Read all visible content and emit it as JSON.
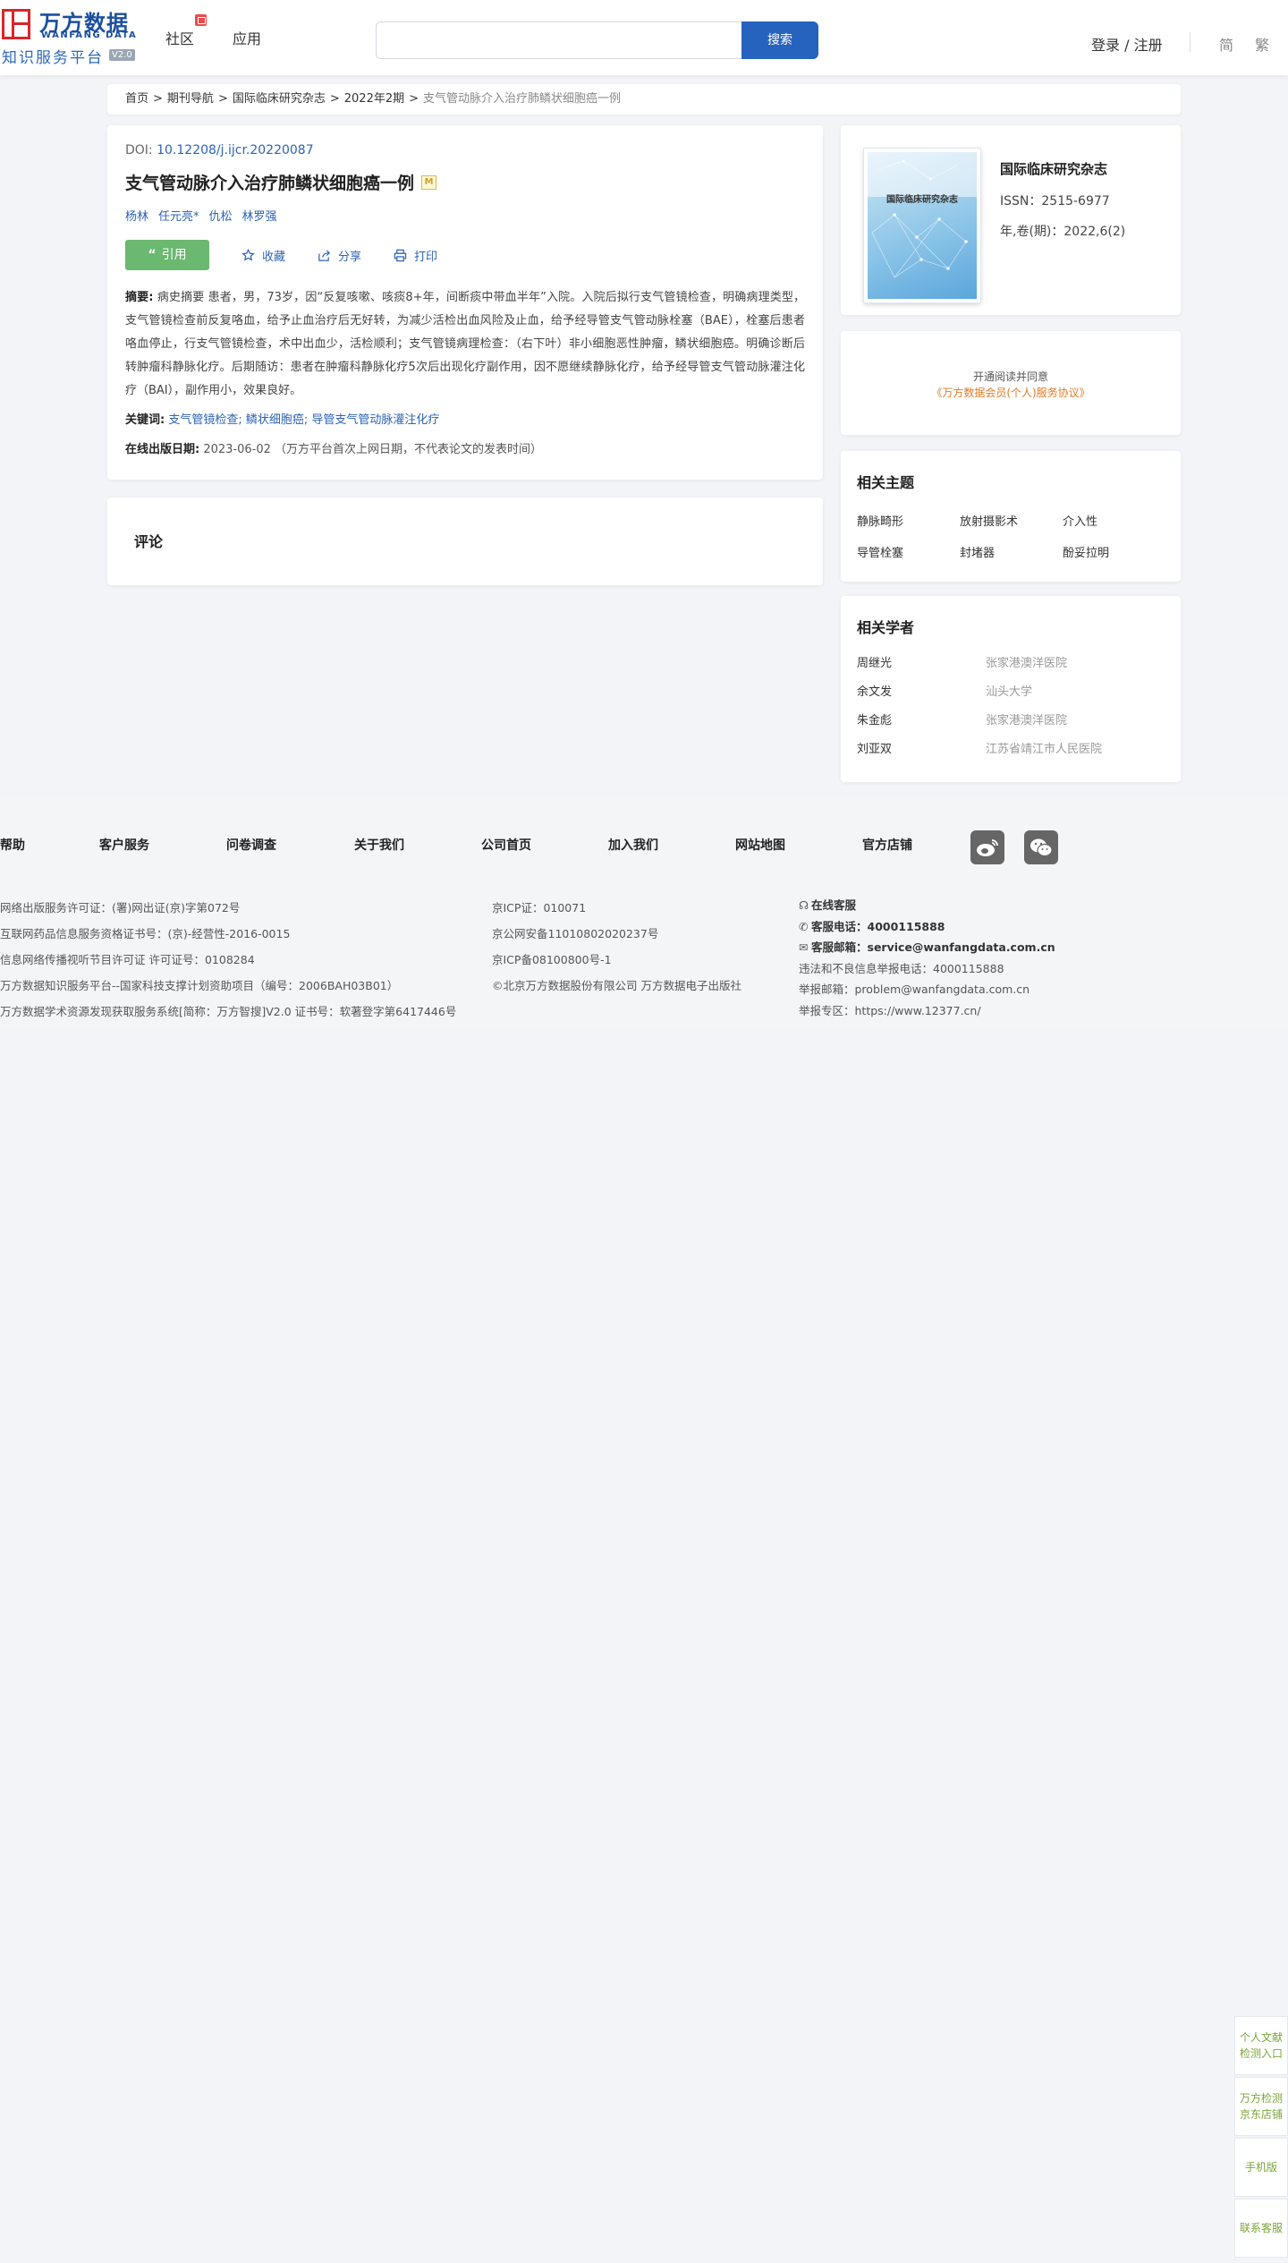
{
  "header": {
    "logo_cn": "万方数据",
    "logo_en": "WANFANG DATA",
    "logo_sub": "知识服务平台",
    "logo_ver": "V2.0",
    "nav": [
      "社区",
      "应用"
    ],
    "search_placeholder": "",
    "search_button": "搜索",
    "login": "登录 / 注册",
    "lang_simplified": "简",
    "lang_traditional": "繁"
  },
  "breadcrumb": {
    "items": [
      "首页",
      "期刊导航",
      "国际临床研究杂志",
      "2022年2期"
    ],
    "current": "支气管动脉介入治疗肺鳞状细胞癌一例"
  },
  "article": {
    "doi_label": "DOI:",
    "doi": "10.12208/j.ijcr.20220087",
    "title": "支气管动脉介入治疗肺鳞状细胞癌一例",
    "title_badge": "M",
    "authors": [
      "杨林",
      "任元亮*",
      "仇松",
      "林罗强"
    ],
    "actions": {
      "cite": "引用",
      "favorite": "收藏",
      "share": "分享",
      "print": "打印"
    },
    "abstract_label": "摘要:",
    "abstract": "病史摘要 患者，男，73岁，因“反复咳嗽、咳痰8+年，间断痰中带血半年”入院。入院后拟行支气管镜检查，明确病理类型，支气管镜检查前反复咯血，给予止血治疗后无好转，为减少活检出血风险及止血，给予经导管支气管动脉栓塞（BAE），栓塞后患者咯血停止，行支气管镜检查，术中出血少，活检顺利；支气管镜病理检查：（右下叶）非小细胞恶性肿瘤，鳞状细胞癌。明确诊断后转肿瘤科静脉化疗。后期随访：患者在肿瘤科静脉化疗5次后出现化疗副作用，因不愿继续静脉化疗，给予经导管支气管动脉灌注化疗（BAI），副作用小，效果良好。",
    "keywords_label": "关键词:",
    "keywords": [
      "支气管镜检查;",
      "鳞状细胞癌;",
      "导管支气管动脉灌注化疗"
    ],
    "pubdate_label": "在线出版日期:",
    "pubdate": "2023-06-02 （万方平台首次上网日期，不代表论文的发表时间）"
  },
  "comments": {
    "title": "评论"
  },
  "journal": {
    "cover_title": "国际临床研究杂志",
    "name": "国际临床研究杂志",
    "issn": "ISSN：2515-6977",
    "volume": "年,卷(期)：2022,6(2)"
  },
  "member": {
    "line1": "开通阅读并同意",
    "line2": "《万方数据会员(个人)服务协议》"
  },
  "topics": {
    "title": "相关主题",
    "items": [
      "静脉畸形",
      "放射摄影术",
      "介入性",
      "导管栓塞",
      "封堵器",
      "酚妥拉明"
    ]
  },
  "scholars": {
    "title": "相关学者",
    "items": [
      {
        "name": "周继光",
        "org": "张家港澳洋医院"
      },
      {
        "name": "余文发",
        "org": "汕头大学"
      },
      {
        "name": "朱金彪",
        "org": "张家港澳洋医院"
      },
      {
        "name": "刘亚双",
        "org": "江苏省靖江市人民医院"
      }
    ]
  },
  "footer": {
    "nav": [
      "帮助",
      "客户服务",
      "问卷调查",
      "关于我们",
      "公司首页",
      "加入我们",
      "网站地图",
      "官方店铺"
    ],
    "col1": [
      "网络出版服务许可证：(署)网出证(京)字第072号",
      "互联网药品信息服务资格证书号：(京)-经营性-2016-0015",
      "信息网络传播视听节目许可证 许可证号：0108284",
      "万方数据知识服务平台--国家科技支撑计划资助项目（编号：2006BAH03B01）",
      "万方数据学术资源发现获取服务系统[简称：万方智搜]V2.0 证书号：软著登字第6417446号"
    ],
    "col2": [
      "京ICP证：010071",
      "京公网安备11010802020237号",
      "京ICP备08100800号-1",
      "©北京万方数据股份有限公司 万方数据电子出版社"
    ],
    "online_service": "在线客服",
    "phone_label": "客服电话：",
    "phone": "4000115888",
    "email_label": "客服邮箱：",
    "email": "service@wanfangdata.com.cn",
    "report_phone": "违法和不良信息举报电话：4000115888",
    "report_email": "举报邮箱：problem@wanfangdata.com.cn",
    "report_zone": "举报专区：https://www.12377.cn/"
  },
  "float_panel": [
    "个人文献检测入口",
    "万方检测京东店铺",
    "手机版",
    "联系客服"
  ]
}
